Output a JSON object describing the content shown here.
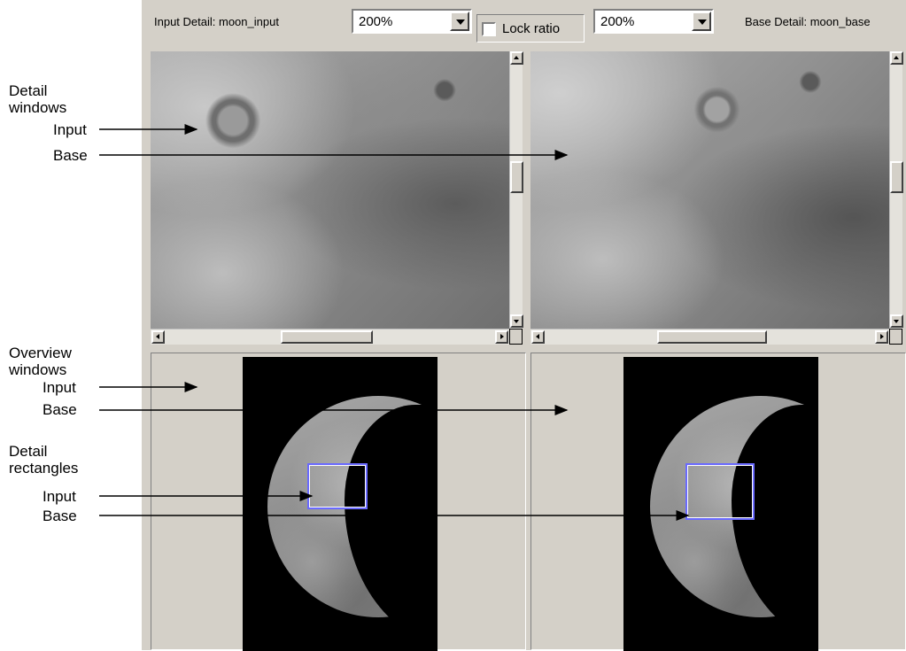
{
  "toolbar": {
    "input_detail_label": "Input Detail: moon_input",
    "input_zoom": "200%",
    "lock_ratio_label": "Lock ratio",
    "lock_ratio_checked": false,
    "base_zoom": "200%",
    "base_detail_label": "Base Detail: moon_base"
  },
  "annotations": {
    "detail_windows": {
      "title": "Detail windows",
      "input": "Input",
      "base": "Base"
    },
    "overview_windows": {
      "title": "Overview windows",
      "input": "Input",
      "base": "Base"
    },
    "detail_rectangles": {
      "title": "Detail rectangles",
      "input": "Input",
      "base": "Base"
    }
  },
  "colors": {
    "window_face": "#d4d0c8",
    "detail_rect_outline": "#6a6aff",
    "overview_background": "#000000"
  },
  "icons": {
    "dropdown": "chevron-down-icon",
    "scroll_up": "arrow-up-icon",
    "scroll_down": "arrow-down-icon",
    "scroll_left": "arrow-left-icon",
    "scroll_right": "arrow-right-icon"
  }
}
